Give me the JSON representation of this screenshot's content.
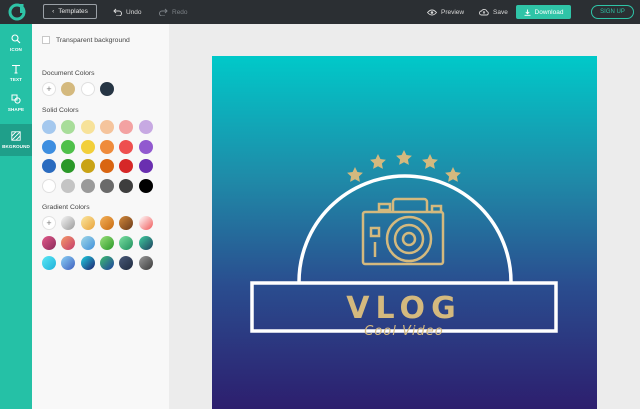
{
  "toolbar": {
    "templates_label": "Templates",
    "undo_label": "Undo",
    "redo_label": "Redo",
    "preview_label": "Preview",
    "save_label": "Save",
    "download_label": "Download",
    "signup_label": "SIGN UP"
  },
  "rail": {
    "items": [
      {
        "label": "ICON",
        "icon": "search-icon"
      },
      {
        "label": "TEXT",
        "icon": "text-icon"
      },
      {
        "label": "SHAPE",
        "icon": "shape-icon"
      },
      {
        "label": "BKGROUND",
        "icon": "background-icon",
        "active": true
      }
    ]
  },
  "panel": {
    "transparent_label": "Transparent background",
    "document_colors_title": "Document Colors",
    "solid_colors_title": "Solid Colors",
    "gradient_colors_title": "Gradient Colors",
    "add_symbol": "+",
    "document_colors": [
      "#d4b97e",
      "#ffffff",
      "#263544"
    ],
    "solid_colors": [
      [
        "#a4c8ee",
        "#a8dd9a",
        "#f7e29a",
        "#f5c49c",
        "#f3a2a2",
        "#c7a9e2"
      ],
      [
        "#3d8ee0",
        "#4fc04a",
        "#f2cf3a",
        "#ef8b3b",
        "#ee4f4f",
        "#9159cf"
      ],
      [
        "#2a6bbf",
        "#2a9828",
        "#c9a315",
        "#d96511",
        "#d62727",
        "#6a2fb0"
      ],
      [
        "#ffffff",
        "#c4c4c4",
        "#9a9a9a",
        "#6a6a6a",
        "#3e3e3e",
        "#000000"
      ]
    ],
    "gradient_colors": [
      [
        null,
        "#c9c9c9",
        "#f5c36a",
        "#e58e2a",
        "#9c5b2b",
        "#f59c9c"
      ],
      [
        "#c43b76",
        "#e46b6b",
        "#6fb7d9",
        "#5abf5a",
        "#3fbf7f",
        "#2a8f7f"
      ],
      [
        "#2ad1e8",
        "#3f8fd9",
        "#1f3f8f",
        "#2a5f9f",
        "#2f3f5f",
        "#6a6a6a"
      ]
    ]
  },
  "design": {
    "title": "VLOG",
    "subtitle": "Cool Video",
    "gold": "#d4b97e"
  },
  "colors": {
    "accent": "#2fc4a7",
    "topbar": "#2b2f33"
  }
}
